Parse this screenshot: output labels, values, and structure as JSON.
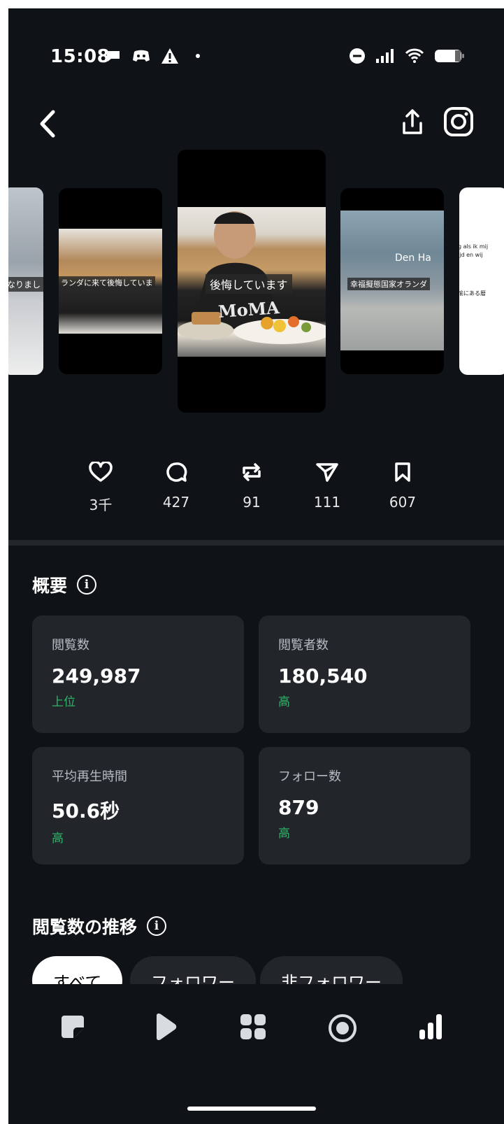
{
  "status_bar": {
    "time": "15:08",
    "icons": [
      "chat-bubble-icon",
      "discord-icon",
      "warning-icon",
      "dot-icon",
      "dnd-icon",
      "signal-icon",
      "wifi-icon",
      "battery-icon"
    ]
  },
  "header": {
    "icons": [
      "back-icon",
      "share-icon",
      "instagram-icon"
    ]
  },
  "carousel": {
    "slides": [
      {
        "subtitle": "なりまし"
      },
      {
        "subtitle": "ランダに来て後悔していま"
      },
      {
        "subtitle": "後悔しています",
        "shirt": "MoMA"
      },
      {
        "subtitle": "幸福擬態国家オランダ",
        "sign": "Den Ha"
      },
      {
        "text_lines": [
          "g als ik mij",
          "ijd en wij",
          "愉にある暦"
        ]
      }
    ]
  },
  "actions": [
    {
      "icon": "heart-icon",
      "count": "3千"
    },
    {
      "icon": "comment-icon",
      "count": "427"
    },
    {
      "icon": "repost-icon",
      "count": "91"
    },
    {
      "icon": "send-icon",
      "count": "111"
    },
    {
      "icon": "bookmark-icon",
      "count": "607"
    }
  ],
  "overview": {
    "title": "概要",
    "info": "i",
    "stats": [
      {
        "label": "閲覧数",
        "value": "249,987",
        "rank": "上位"
      },
      {
        "label": "閲覧者数",
        "value": "180,540",
        "rank": "高"
      },
      {
        "label": "平均再生時間",
        "value": "50.6秒",
        "rank": "高"
      },
      {
        "label": "フォロー数",
        "value": "879",
        "rank": "高"
      }
    ]
  },
  "trend": {
    "title": "閲覧数の推移",
    "info": "i",
    "chips": [
      "すべて",
      "フォロワー",
      "非フォロワー"
    ]
  },
  "bottom_nav": [
    "posts-icon",
    "reels-icon",
    "grid-icon",
    "live-icon",
    "insights-icon"
  ],
  "colors": {
    "background": "#0f1216",
    "card": "#22262b",
    "accent_green": "#2fb46a"
  }
}
